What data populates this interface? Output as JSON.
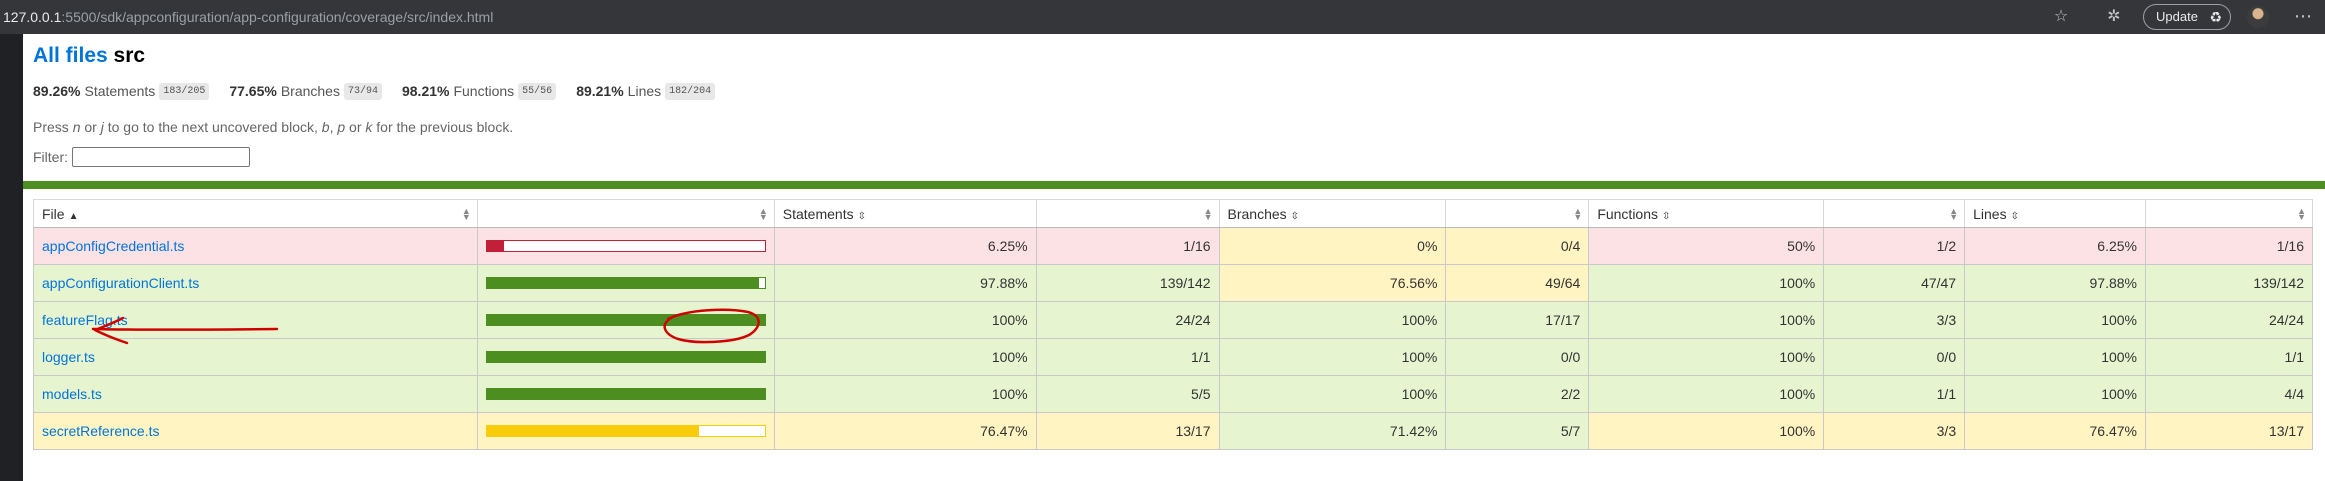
{
  "browser": {
    "url_host": "127.0.0.1",
    "url_rest": ":5500/sdk/appconfiguration/app-configuration/coverage/src/index.html",
    "update_label": "Update",
    "menu_label": "⋯"
  },
  "header": {
    "all_files_link": "All files",
    "folder": "src"
  },
  "summary": [
    {
      "pct": "89.26%",
      "label": "Statements",
      "fraction": "183/205"
    },
    {
      "pct": "77.65%",
      "label": "Branches",
      "fraction": "73/94"
    },
    {
      "pct": "98.21%",
      "label": "Functions",
      "fraction": "55/56"
    },
    {
      "pct": "89.21%",
      "label": "Lines",
      "fraction": "182/204"
    }
  ],
  "hint": {
    "pre": "Press ",
    "n": "n",
    "or1": " or ",
    "j": "j",
    "mid": " to go to the next uncovered block, ",
    "b": "b",
    "comma": ", ",
    "p": "p",
    "or2": " or ",
    "k": "k",
    "post": " for the previous block."
  },
  "filter": {
    "label": "Filter:",
    "value": ""
  },
  "table": {
    "headers": {
      "file": "File",
      "statements": "Statements",
      "branches": "Branches",
      "functions": "Functions",
      "lines": "Lines"
    },
    "rows": [
      {
        "file": "appConfigCredential.ts",
        "bar_pct": 6.25,
        "bar_level": "low",
        "stmt_pct": "6.25%",
        "stmt_frac": "1/16",
        "branch_pct": "0%",
        "branch_frac": "0/4",
        "func_pct": "50%",
        "func_frac": "1/2",
        "line_pct": "6.25%",
        "line_frac": "1/16",
        "cls": [
          "low",
          "low",
          "low",
          "low",
          "medium",
          "medium",
          "low",
          "low"
        ]
      },
      {
        "file": "appConfigurationClient.ts",
        "bar_pct": 97.88,
        "bar_level": "high",
        "stmt_pct": "97.88%",
        "stmt_frac": "139/142",
        "branch_pct": "76.56%",
        "branch_frac": "49/64",
        "func_pct": "100%",
        "func_frac": "47/47",
        "line_pct": "97.88%",
        "line_frac": "139/142",
        "cls": [
          "high",
          "high",
          "high",
          "high",
          "medium",
          "medium",
          "high",
          "high"
        ]
      },
      {
        "file": "featureFlag.ts",
        "bar_pct": 100,
        "bar_level": "high",
        "stmt_pct": "100%",
        "stmt_frac": "24/24",
        "branch_pct": "100%",
        "branch_frac": "17/17",
        "func_pct": "100%",
        "func_frac": "3/3",
        "line_pct": "100%",
        "line_frac": "24/24",
        "cls": [
          "high",
          "high",
          "high",
          "high",
          "high",
          "high",
          "high",
          "high"
        ]
      },
      {
        "file": "logger.ts",
        "bar_pct": 100,
        "bar_level": "high",
        "stmt_pct": "100%",
        "stmt_frac": "1/1",
        "branch_pct": "100%",
        "branch_frac": "0/0",
        "func_pct": "100%",
        "func_frac": "0/0",
        "line_pct": "100%",
        "line_frac": "1/1",
        "cls": [
          "high",
          "high",
          "high",
          "high",
          "high",
          "high",
          "high",
          "high"
        ]
      },
      {
        "file": "models.ts",
        "bar_pct": 100,
        "bar_level": "high",
        "stmt_pct": "100%",
        "stmt_frac": "5/5",
        "branch_pct": "100%",
        "branch_frac": "2/2",
        "func_pct": "100%",
        "func_frac": "1/1",
        "line_pct": "100%",
        "line_frac": "4/4",
        "cls": [
          "high",
          "high",
          "high",
          "high",
          "high",
          "high",
          "high",
          "high"
        ]
      },
      {
        "file": "secretReference.ts",
        "bar_pct": 76.47,
        "bar_level": "medium",
        "stmt_pct": "76.47%",
        "stmt_frac": "13/17",
        "branch_pct": "71.42%",
        "branch_frac": "5/7",
        "func_pct": "100%",
        "func_frac": "3/3",
        "line_pct": "76.47%",
        "line_frac": "13/17",
        "cls": [
          "medium",
          "medium",
          "medium",
          "medium",
          "high",
          "high",
          "medium",
          "medium"
        ]
      }
    ]
  },
  "colors": {
    "low": "#fce1e5",
    "medium": "#fff4c2",
    "high": "#e6f5d0",
    "bar_low": "#c21f39",
    "bar_high": "#4d8e20",
    "bar_medium": "#f9cd0b",
    "link": "#0074d9",
    "annotation": "#d00000"
  }
}
